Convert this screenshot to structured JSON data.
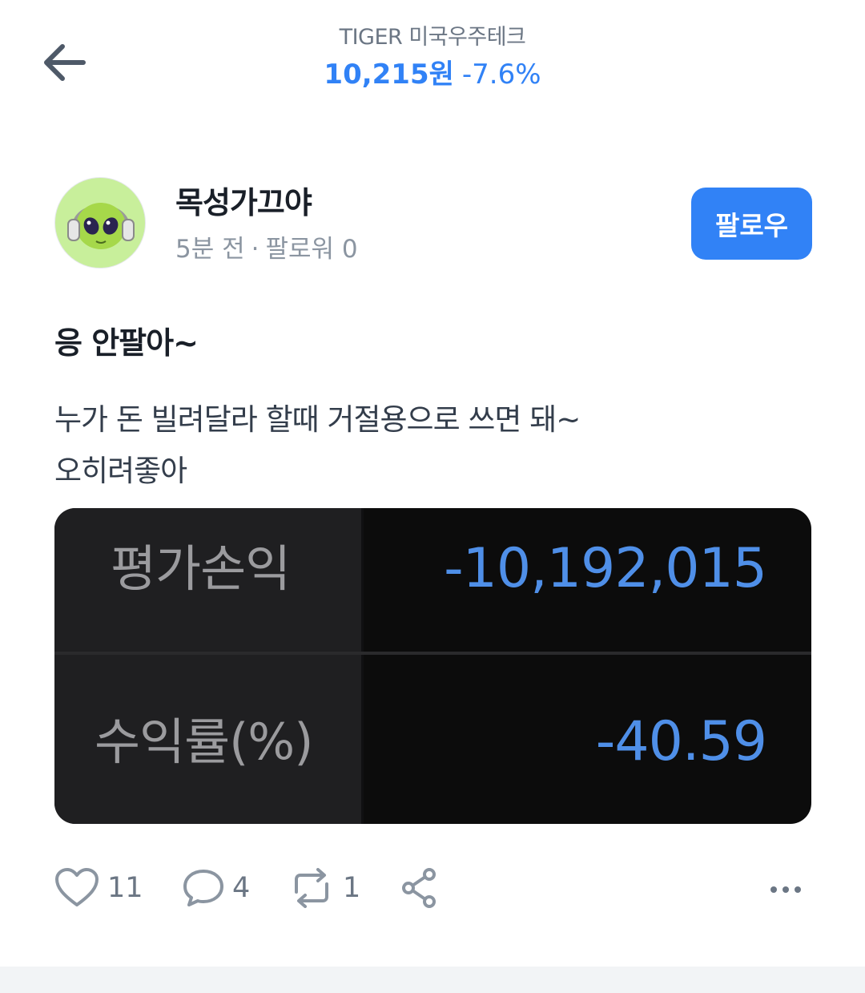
{
  "header": {
    "stock_name": "TIGER 미국우주테크",
    "price": "10,215원",
    "change": "-7.6%"
  },
  "author": {
    "name": "목성가끄야",
    "time": "5분 전",
    "followers": "팔로워 0",
    "dot": "·",
    "follow_label": "팔로우"
  },
  "post": {
    "title": "응 안팔아~",
    "body_lines": [
      "누가 돈 빌려달라 할때 거절용으로 쓰면 돼~",
      "오히려좋아"
    ]
  },
  "image_card": {
    "rows": [
      {
        "label": "평가손익",
        "value": "-10,192,015"
      },
      {
        "label": "수익률(%)",
        "value": "-40.59"
      }
    ]
  },
  "actions": {
    "likes": "11",
    "comments": "4",
    "reposts": "1"
  },
  "colors": {
    "accent": "#3182f6",
    "card_value": "#4f8fe8"
  }
}
